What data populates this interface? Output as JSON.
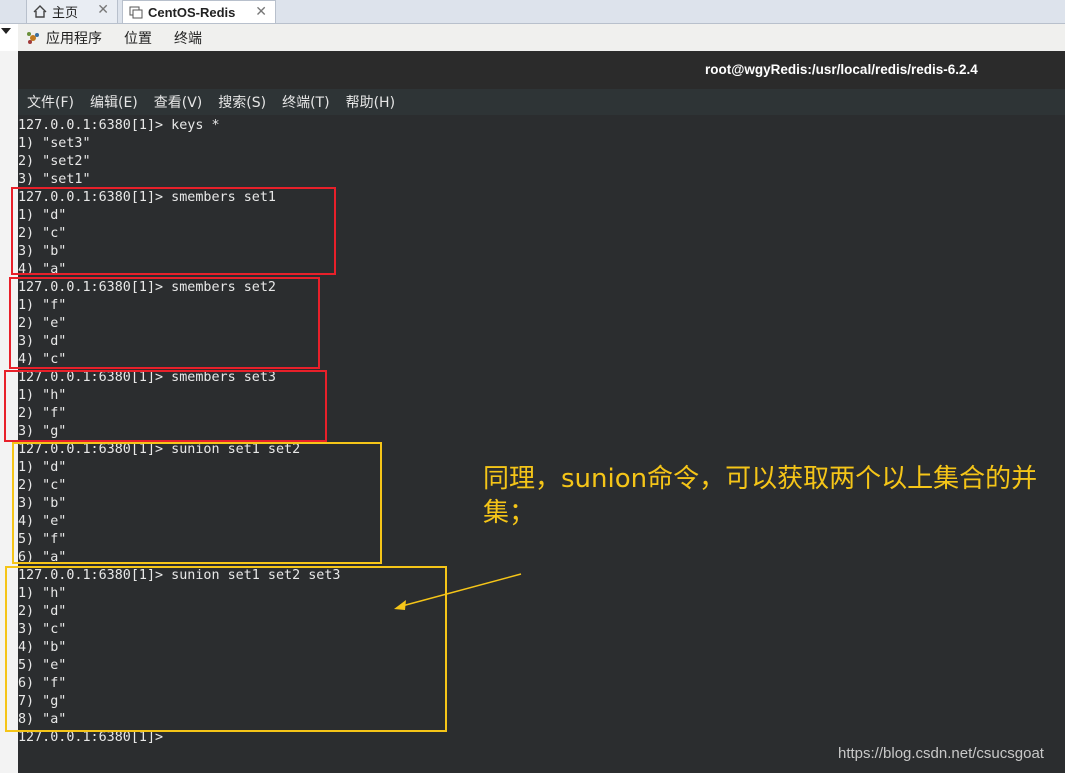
{
  "tabs": [
    {
      "label": "主页",
      "close": "✕"
    },
    {
      "label": "CentOS-Redis",
      "close": "✕"
    }
  ],
  "gnome_menu": [
    "应用程序",
    "位置",
    "终端"
  ],
  "window_title": "root@wgyRedis:/usr/local/redis/redis-6.2.4",
  "terminal_menu": [
    "文件(F)",
    "编辑(E)",
    "查看(V)",
    "搜索(S)",
    "终端(T)",
    "帮助(H)"
  ],
  "terminal_lines": [
    "127.0.0.1:6380[1]> keys *",
    "1) \"set3\"",
    "2) \"set2\"",
    "3) \"set1\"",
    "127.0.0.1:6380[1]> smembers set1",
    "1) \"d\"",
    "2) \"c\"",
    "3) \"b\"",
    "4) \"a\"",
    "127.0.0.1:6380[1]> smembers set2",
    "1) \"f\"",
    "2) \"e\"",
    "3) \"d\"",
    "4) \"c\"",
    "127.0.0.1:6380[1]> smembers set3",
    "1) \"h\"",
    "2) \"f\"",
    "3) \"g\"",
    "127.0.0.1:6380[1]> sunion set1 set2",
    "1) \"d\"",
    "2) \"c\"",
    "3) \"b\"",
    "4) \"e\"",
    "5) \"f\"",
    "6) \"a\"",
    "127.0.0.1:6380[1]> sunion set1 set2 set3",
    "1) \"h\"",
    "2) \"d\"",
    "3) \"c\"",
    "4) \"b\"",
    "5) \"e\"",
    "6) \"f\"",
    "7) \"g\"",
    "8) \"a\"",
    "127.0.0.1:6380[1]> "
  ],
  "annotation": "同理，sunion命令，可以获取两个以上集合的并集；",
  "watermark": "https://blog.csdn.net/csucsgoat",
  "colors": {
    "red_box": "#e8202a",
    "yellow_box": "#f5c518",
    "terminal_bg": "#2b2d2f"
  }
}
